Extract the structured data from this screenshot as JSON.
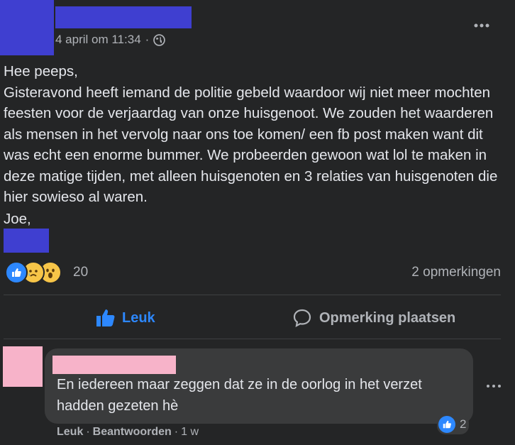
{
  "post": {
    "timestamp": "4 april om 11:34",
    "separator": "·",
    "greeting": "Hee peeps,",
    "body": "Gisteravond heeft iemand de politie gebeld waardoor wij niet meer mochten feesten voor de verjaardag van onze huisgenoot. We zouden het waarderen als mensen in het vervolg naar ons toe komen/ een fb post maken want dit was echt een enorme bummer. We probeerden gewoon wat lol te maken in deze matige tijden, met alleen huisgenoten en 3 relaties van huisgenoten die hier sowieso al waren.",
    "signoff": "Joe,",
    "reaction_count": "20",
    "comment_count": "2 opmerkingen",
    "audience_icon": "public-globe-icon"
  },
  "actions": {
    "like_label": "Leuk",
    "comment_label": "Opmerking plaatsen"
  },
  "comment": {
    "text": "En iedereen maar zeggen dat ze in de oorlog in het verzet hadden gezeten hè",
    "like_count": "2",
    "like_action": "Leuk",
    "reply_action": "Beantwoorden",
    "separator": "·",
    "age": "1 w"
  },
  "colors": {
    "background": "#242526",
    "accent_blue": "#2d88ff",
    "bubble": "#3a3b3c",
    "redaction_blue": "#3f3fd0",
    "redaction_pink": "#f7b3c9"
  }
}
